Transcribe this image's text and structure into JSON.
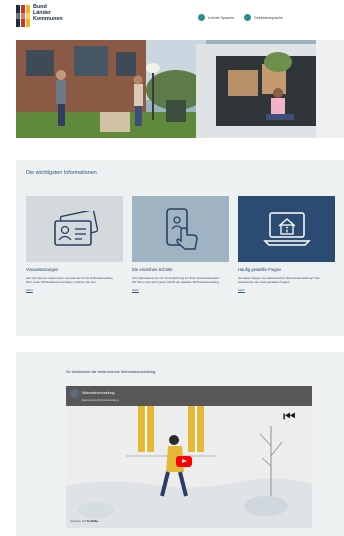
{
  "header": {
    "logo_lines": [
      "Bund",
      "Länder",
      "Kommunen"
    ],
    "links": [
      {
        "label": "Leichte Sprache",
        "icon": "leichte-sprache-icon"
      },
      {
        "label": "Gebärdensprache",
        "icon": "gebaerdensprache-icon"
      }
    ]
  },
  "info": {
    "title": "Die wichtigsten Informationen",
    "cards": [
      {
        "title": "Voraussetzungen",
        "text": "Hier den Service nutzen kann und was Sie für die Onlineanmeldung Ihrer neuen Wohnadresse benötigen, erfahren Sie hier.",
        "more": "Mehr",
        "icon": "id-card-icon",
        "bg": "#d4d9dc"
      },
      {
        "title": "Die einzelnen Schritte",
        "text": "Vom Nutzerkonto bis zur Terminbuchung zur Ihren Personalausweis: Wir führen Sie durch jeden Schritt der digitalen Wohnsitzanmeldung.",
        "more": "Mehr",
        "icon": "phone-tap-icon",
        "bg": "#9fb3c3"
      },
      {
        "title": "Häufig gestellte Fragen",
        "text": "Sie haben Fragen zur elektronischen Wohnsitzanmeldung? Hier beantworten die meist gestellten Fragen.",
        "more": "Mehr",
        "icon": "laptop-house-icon",
        "bg": "#2b4b72"
      }
    ]
  },
  "video": {
    "title": "So funktioniert die elektronische Wohnsitzanmeldung",
    "channel": "Wohnsitzanmeldung",
    "subtitle": "Elektronische Wohnsitzanmeldung",
    "footer": "Ansehen auf",
    "footer_brand": "YouTube"
  }
}
